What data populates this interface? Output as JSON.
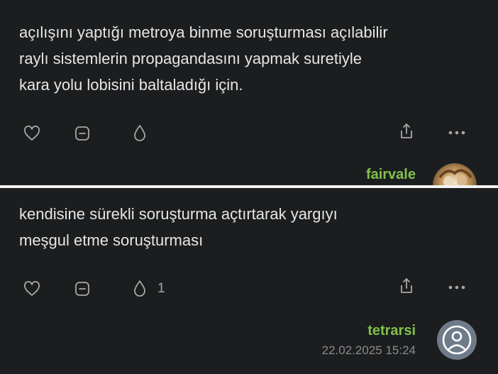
{
  "entries": [
    {
      "text": "açılışını yaptığı metroya binme soruşturması açılabilir\nraylı sistemlerin propagandasını yapmak suretiyle\nkara yolu lobisini baltaladığı için.",
      "author": "fairvale",
      "avatar_icon": "photo-avatar",
      "actions": {
        "like_icon": "heart-outline-icon",
        "favorite_icon": "minus-box-icon",
        "drop_icon": "drop-outline-icon",
        "share_icon": "share-up-icon",
        "more_icon": "ellipsis-icon"
      }
    },
    {
      "text": "kendisine sürekli soruşturma açtırtarak yargıyı\nmeşgul etme soruşturması",
      "author": "tetrarsi",
      "timestamp": "22.02.2025 15:24",
      "drop_count": "1",
      "avatar_icon": "default-user-avatar",
      "actions": {
        "like_icon": "heart-outline-icon",
        "favorite_icon": "minus-box-icon",
        "drop_icon": "drop-outline-icon",
        "share_icon": "share-up-icon",
        "more_icon": "ellipsis-icon"
      }
    }
  ],
  "colors": {
    "background": "#1b1d1f",
    "text": "#e6e6e6",
    "author": "#81c14b",
    "icon": "#a8a8a8",
    "timestamp": "#8c8c8c",
    "divider": "#f2f2f2"
  }
}
